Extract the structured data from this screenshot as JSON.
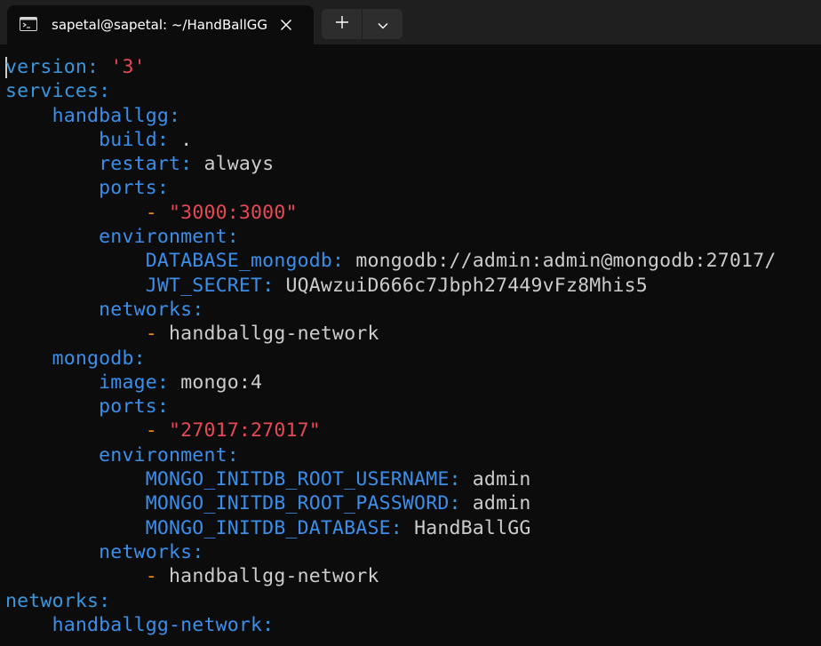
{
  "tab": {
    "title": "sapetal@sapetal: ~/HandBallGG",
    "icon": "terminal-icon"
  },
  "buttons": {
    "close_icon": "close-icon",
    "new_tab_icon": "plus-icon",
    "dropdown_icon": "chevron-down-icon"
  },
  "colors": {
    "background": "#0c0c0c",
    "titlebar": "#1f1f1f",
    "key": "#3a96dd",
    "string": "#e74856",
    "text": "#cccccc",
    "dash": "#e98a15"
  },
  "file": {
    "lines": [
      {
        "indent": "",
        "key": "version",
        "sep": ": ",
        "value": "'3'",
        "vtype": "str"
      },
      {
        "indent": "",
        "key": "services",
        "sep": ":",
        "value": "",
        "vtype": "plain"
      },
      {
        "indent": "    ",
        "key": "handballgg",
        "sep": ":",
        "value": "",
        "vtype": "plain"
      },
      {
        "indent": "        ",
        "key": "build",
        "sep": ": ",
        "value": ".",
        "vtype": "plain"
      },
      {
        "indent": "        ",
        "key": "restart",
        "sep": ": ",
        "value": "always",
        "vtype": "plain"
      },
      {
        "indent": "        ",
        "key": "ports",
        "sep": ":",
        "value": "",
        "vtype": "plain"
      },
      {
        "indent": "            ",
        "dash": "- ",
        "value": "\"3000:3000\"",
        "vtype": "str"
      },
      {
        "indent": "        ",
        "key": "environment",
        "sep": ":",
        "value": "",
        "vtype": "plain"
      },
      {
        "indent": "            ",
        "key": "DATABASE_mongodb",
        "sep": ": ",
        "value": "mongodb://admin:admin@mongodb:27017/",
        "vtype": "plain"
      },
      {
        "indent": "            ",
        "key": "JWT_SECRET",
        "sep": ": ",
        "value": "UQAwzuiD666c7Jbph27449vFz8Mhis5",
        "vtype": "plain"
      },
      {
        "indent": "        ",
        "key": "networks",
        "sep": ":",
        "value": "",
        "vtype": "plain"
      },
      {
        "indent": "            ",
        "dash": "- ",
        "value": "handballgg-network",
        "vtype": "plain"
      },
      {
        "indent": "    ",
        "key": "mongodb",
        "sep": ":",
        "value": "",
        "vtype": "plain"
      },
      {
        "indent": "        ",
        "key": "image",
        "sep": ": ",
        "value": "mongo:4",
        "vtype": "plain"
      },
      {
        "indent": "        ",
        "key": "ports",
        "sep": ":",
        "value": "",
        "vtype": "plain"
      },
      {
        "indent": "            ",
        "dash": "- ",
        "value": "\"27017:27017\"",
        "vtype": "str"
      },
      {
        "indent": "        ",
        "key": "environment",
        "sep": ":",
        "value": "",
        "vtype": "plain"
      },
      {
        "indent": "            ",
        "key": "MONGO_INITDB_ROOT_USERNAME",
        "sep": ": ",
        "value": "admin",
        "vtype": "plain"
      },
      {
        "indent": "            ",
        "key": "MONGO_INITDB_ROOT_PASSWORD",
        "sep": ": ",
        "value": "admin",
        "vtype": "plain"
      },
      {
        "indent": "            ",
        "key": "MONGO_INITDB_DATABASE",
        "sep": ": ",
        "value": "HandBallGG",
        "vtype": "plain"
      },
      {
        "indent": "        ",
        "key": "networks",
        "sep": ":",
        "value": "",
        "vtype": "plain"
      },
      {
        "indent": "            ",
        "dash": "- ",
        "value": "handballgg-network",
        "vtype": "plain"
      },
      {
        "indent": "",
        "key": "networks",
        "sep": ":",
        "value": "",
        "vtype": "plain"
      },
      {
        "indent": "    ",
        "key": "handballgg-network",
        "sep": ":",
        "value": "",
        "vtype": "plain"
      }
    ]
  }
}
